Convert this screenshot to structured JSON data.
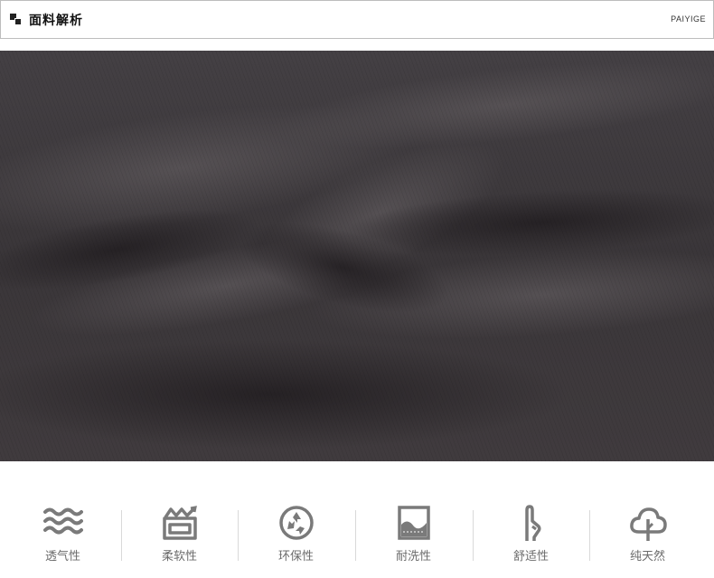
{
  "header": {
    "title": "面料解析",
    "brand": "PAIYIGE"
  },
  "fabric_image": {
    "description_icon": "fabric-closeup-photo",
    "color": "#3d393c"
  },
  "features": [
    {
      "label": "透气性",
      "icon": "waves-icon"
    },
    {
      "label": "柔软性",
      "icon": "soft-box-icon"
    },
    {
      "label": "环保性",
      "icon": "recycle-icon"
    },
    {
      "label": "耐洗性",
      "icon": "wash-frame-icon"
    },
    {
      "label": "舒适性",
      "icon": "hand-icon"
    },
    {
      "label": "纯天然",
      "icon": "tree-icon"
    }
  ],
  "colors": {
    "icon": "#7a7a7a",
    "label": "#6b6b6b",
    "separator": "#d9d9d9"
  }
}
